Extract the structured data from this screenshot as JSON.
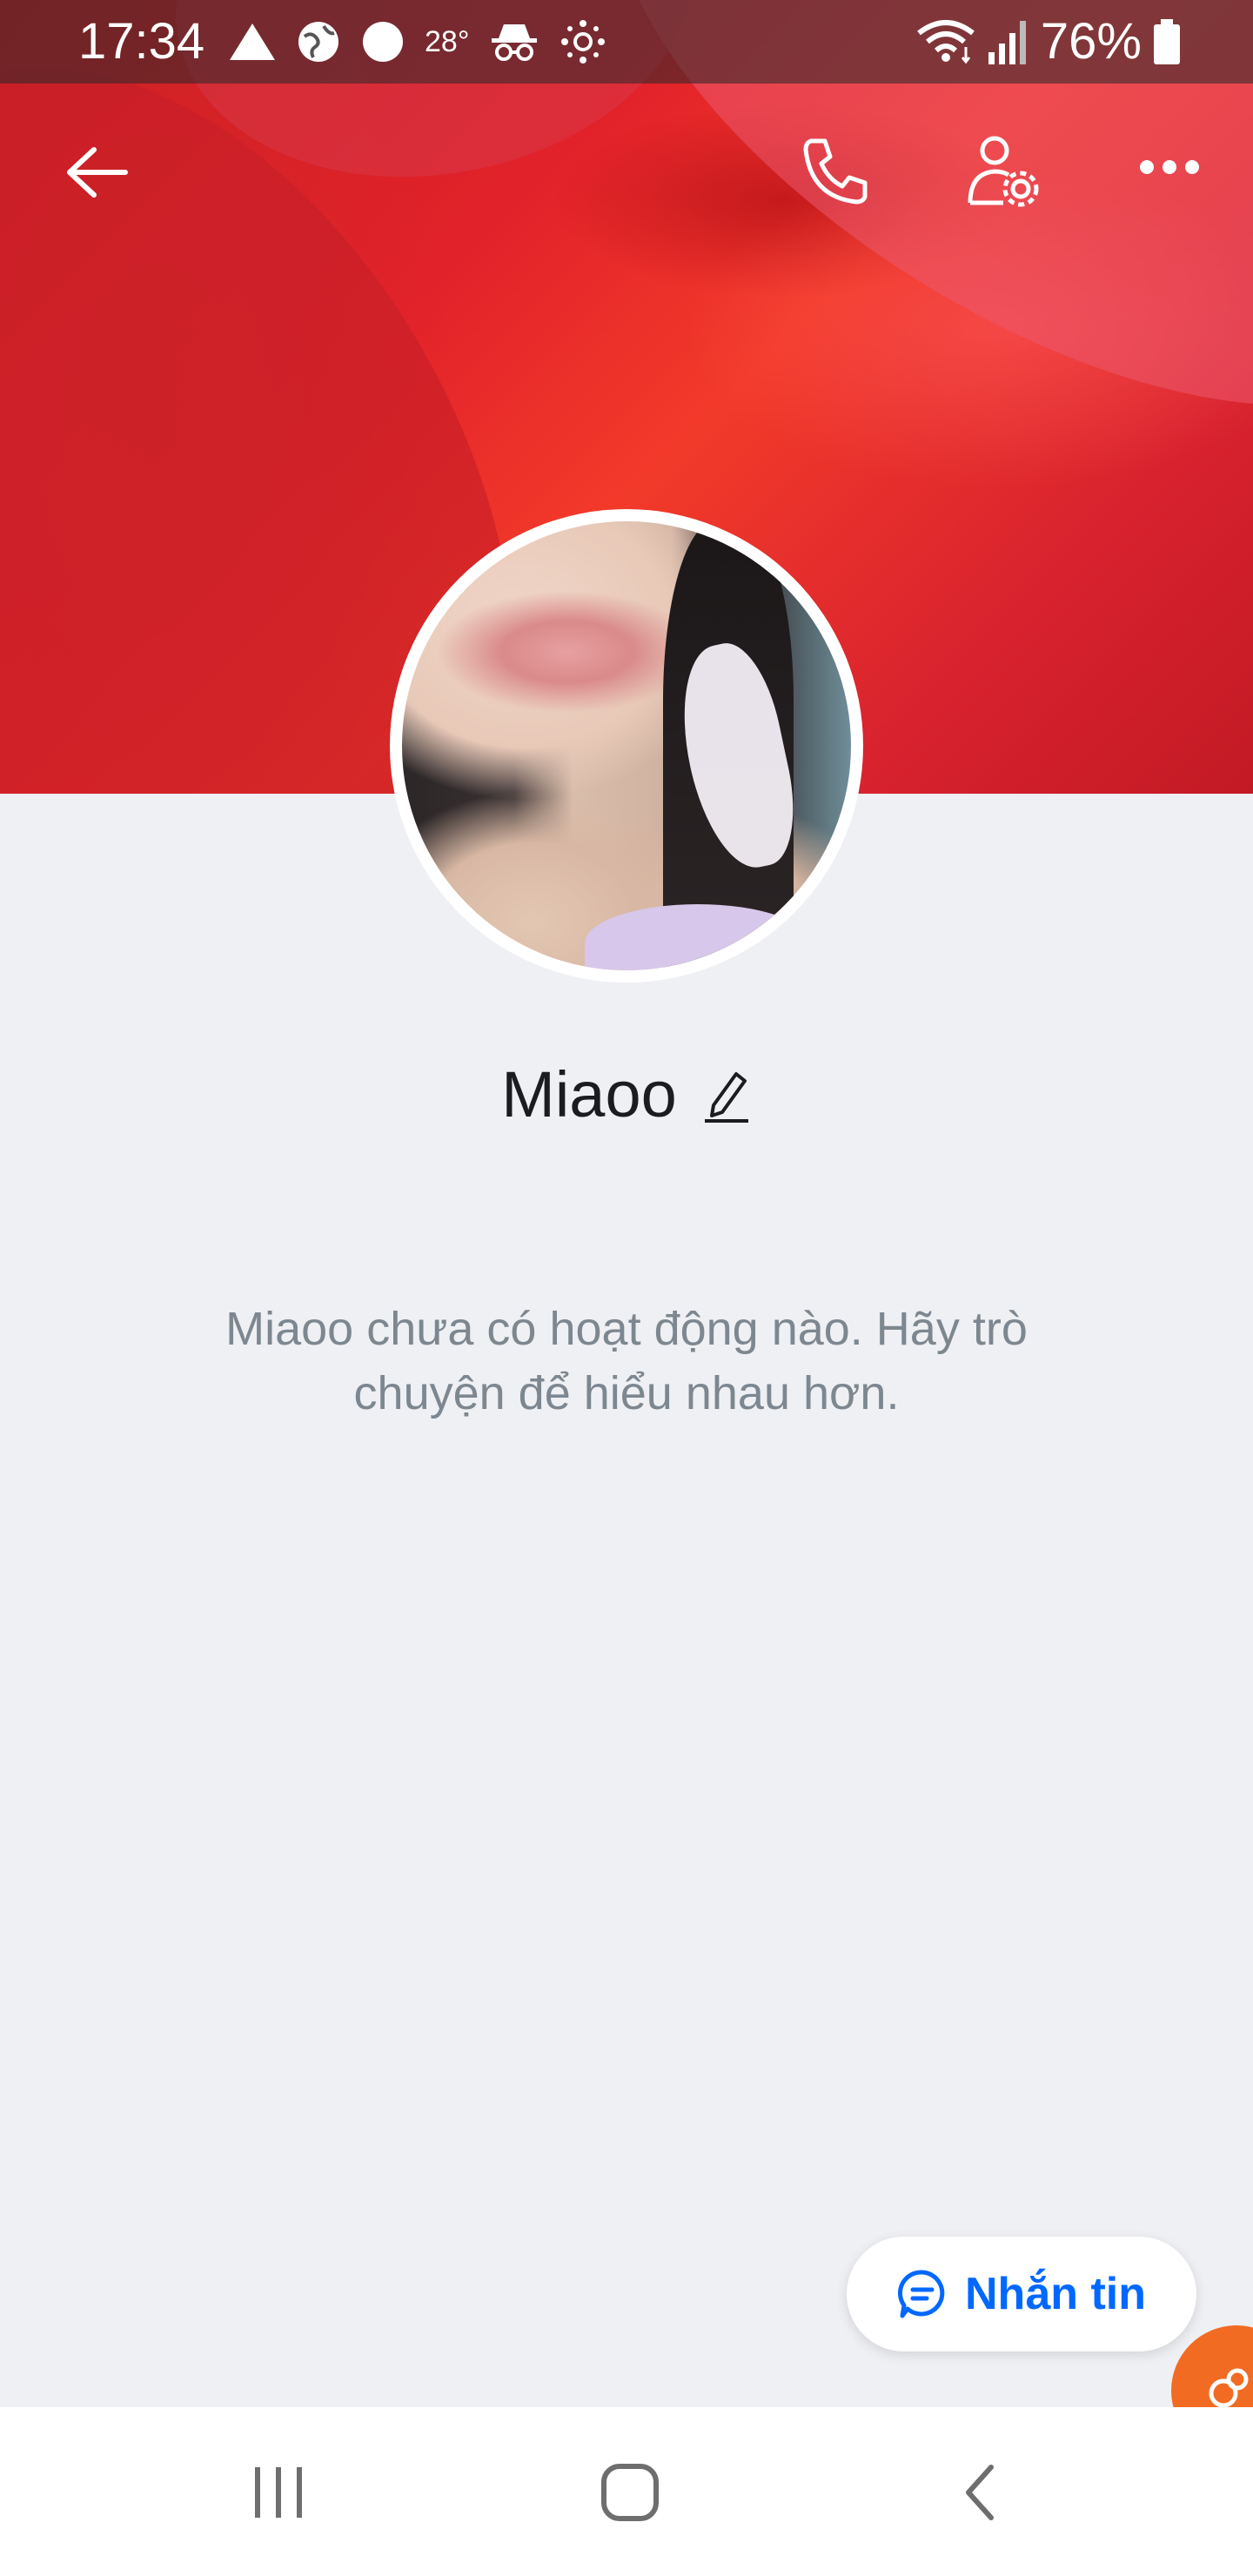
{
  "status_bar": {
    "time": "17:34",
    "temperature": "28°",
    "battery": "76%",
    "icons": [
      "triangle-icon",
      "globe-icon",
      "circle-icon",
      "incognito-icon",
      "settings-dots-icon",
      "wifi-icon",
      "signal-icon",
      "battery-icon"
    ]
  },
  "header": {
    "back_icon": "arrow-left-icon",
    "call_icon": "phone-icon",
    "profile_settings_icon": "user-gear-icon",
    "more_icon": "more-horizontal-icon"
  },
  "profile": {
    "name": "Miaoo",
    "edit_icon": "pencil-icon",
    "empty_message": "Miaoo chưa có hoạt động nào. Hãy trò chuyện để hiểu nhau hơn."
  },
  "actions": {
    "message_label": "Nhắn tin",
    "message_icon": "chat-bubble-icon"
  },
  "colors": {
    "accent": "#0068ff",
    "background": "#eff0f4",
    "bubble": "#f26b22"
  },
  "nav": {
    "recent_icon": "recent-apps-icon",
    "home_icon": "home-icon",
    "back_icon": "nav-back-icon"
  }
}
